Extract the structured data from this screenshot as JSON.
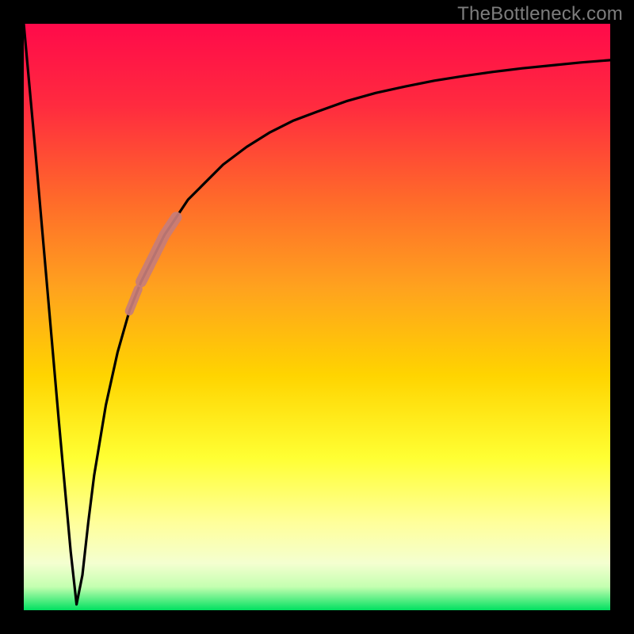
{
  "watermark": "TheBottleneck.com",
  "colors": {
    "frame": "#000000",
    "curve": "#000000",
    "highlight": "#c77d7a",
    "gradient_top": "#ff0a4a",
    "gradient_mid_upper": "#ff7a1e",
    "gradient_mid": "#ffd400",
    "gradient_mid_lower": "#ffff66",
    "gradient_pale": "#f6ffcf",
    "gradient_bottom": "#00e060"
  },
  "chart_data": {
    "type": "line",
    "title": "",
    "xlabel": "",
    "ylabel": "",
    "xlim": [
      0,
      100
    ],
    "ylim": [
      0,
      100
    ],
    "x": [
      0,
      2,
      4,
      6,
      8,
      9,
      10,
      11,
      12,
      14,
      16,
      18,
      20,
      22,
      24,
      26,
      28,
      30,
      34,
      38,
      42,
      46,
      50,
      55,
      60,
      65,
      70,
      75,
      80,
      85,
      90,
      95,
      100
    ],
    "values": [
      100,
      78,
      55,
      32,
      10,
      1,
      6,
      15,
      23,
      35,
      44,
      51,
      56,
      60,
      64,
      67,
      70,
      72,
      76,
      79,
      81.5,
      83.5,
      85,
      86.8,
      88.2,
      89.3,
      90.3,
      91.1,
      91.8,
      92.4,
      92.9,
      93.4,
      93.8
    ],
    "highlight_segments": [
      {
        "x_range": [
          20,
          26
        ],
        "thickness": 14
      },
      {
        "x_range": [
          18,
          19.5
        ],
        "thickness": 11
      }
    ],
    "notes": "V-shaped bottleneck curve: steep drop to near 0 around x≈9, then asymptotic rise toward ~94 at right edge. Gradient background red→orange→yellow→pale→green top-to-bottom. Muted-red thick overlay on curve roughly x∈[18,26]."
  }
}
